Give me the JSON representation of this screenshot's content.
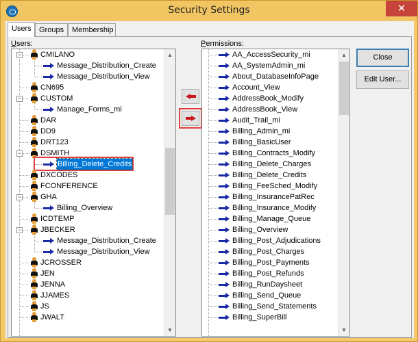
{
  "window": {
    "title": "Security Settings",
    "close_glyph": "✕",
    "app_icon": "app-logo-icon"
  },
  "tabs": [
    {
      "label": "Users",
      "active": true
    },
    {
      "label": "Groups",
      "active": false
    },
    {
      "label": "Membership",
      "active": false
    }
  ],
  "users_label": "Users:",
  "users_label_accel": "U",
  "permissions_label": "Permissions:",
  "permissions_label_accel": "P",
  "users_tree": [
    {
      "label": "CMILANO",
      "type": "user",
      "expanded": true,
      "children": [
        "Message_Distribution_Create",
        "Message_Distribution_View"
      ]
    },
    {
      "label": "CN695",
      "type": "user"
    },
    {
      "label": "CUSTOM",
      "type": "user",
      "expanded": true,
      "children": [
        "Manage_Forms_mi"
      ]
    },
    {
      "label": "DAR",
      "type": "user"
    },
    {
      "label": "DD9",
      "type": "user"
    },
    {
      "label": "DRT123",
      "type": "user"
    },
    {
      "label": "DSMITH",
      "type": "user",
      "expanded": true,
      "children": [
        "Billing_Delete_Credits"
      ],
      "selected_child": "Billing_Delete_Credits"
    },
    {
      "label": "DXCODES",
      "type": "user"
    },
    {
      "label": "FCONFERENCE",
      "type": "user"
    },
    {
      "label": "GHA",
      "type": "user",
      "expanded": true,
      "children": [
        "Billing_Overview"
      ]
    },
    {
      "label": "ICDTEMP",
      "type": "user"
    },
    {
      "label": "JBECKER",
      "type": "user",
      "expanded": true,
      "children": [
        "Message_Distribution_Create",
        "Message_Distribution_View"
      ]
    },
    {
      "label": "JCROSSER",
      "type": "user"
    },
    {
      "label": "JEN",
      "type": "user"
    },
    {
      "label": "JENNA",
      "type": "user"
    },
    {
      "label": "JJAMES",
      "type": "user"
    },
    {
      "label": "JS",
      "type": "user"
    },
    {
      "label": "JWALT",
      "type": "user"
    }
  ],
  "permissions": [
    "AA_AccessSecurity_mi",
    "AA_SystemAdmin_mi",
    "About_DatabaseInfoPage",
    "Account_View",
    "AddressBook_Modify",
    "AddressBook_View",
    "Audit_Trail_mi",
    "Billing_Admin_mi",
    "Billing_BasicUser",
    "Billing_Contracts_Modify",
    "Billing_Delete_Charges",
    "Billing_Delete_Credits",
    "Billing_FeeSched_Modify",
    "Billing_InsurancePatRec",
    "Billing_Insurance_Modify",
    "Billing_Manage_Queue",
    "Billing_Overview",
    "Billing_Post_Adjudications",
    "Billing_Post_Charges",
    "Billing_Post_Payments",
    "Billing_Post_Refunds",
    "Billing_RunDaysheet",
    "Billing_Send_Queue",
    "Billing_Send_Statements",
    "Billing_SuperBill"
  ],
  "buttons": {
    "remove_icon": "left-arrow-icon",
    "add_icon": "right-arrow-icon",
    "close": "Close",
    "edit_user": "Edit User..."
  },
  "colors": {
    "accent_blue": "#0078d7",
    "arrow_red": "#c8141e",
    "arrow_blue": "#1a2aa6",
    "highlight_box": "#e04040",
    "titlebar": "#f2c563"
  }
}
